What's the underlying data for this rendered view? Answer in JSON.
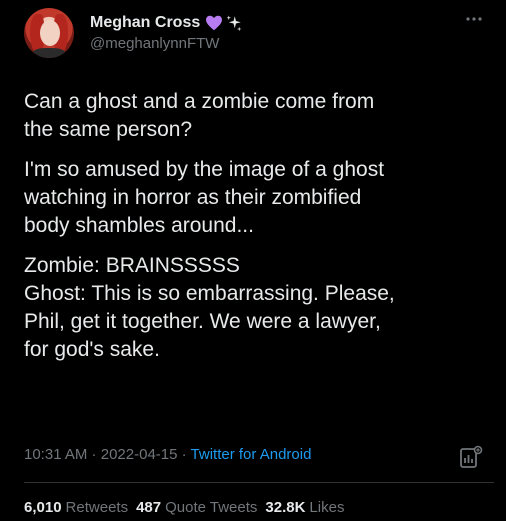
{
  "author": {
    "display_name": "Meghan Cross",
    "handle": "@meghanlynnFTW",
    "badges": [
      "purple-heart-icon",
      "sparkles-icon"
    ],
    "avatar": "user-avatar"
  },
  "tweet": {
    "paragraphs": [
      [
        "Can a ghost and a zombie come from",
        "the same person?"
      ],
      [
        "I'm so amused by the image of a ghost",
        "watching in horror as their zombified",
        "body shambles around..."
      ],
      [
        "Zombie: BRAINSSSSS",
        "Ghost: This is so embarrassing. Please,",
        "Phil, get it together. We were a lawyer,",
        "for god's sake."
      ]
    ]
  },
  "meta": {
    "time": "10:31 AM",
    "sep1": " · ",
    "date": "2022-04-15",
    "sep2": " · ",
    "source": "Twitter for Android"
  },
  "stats": {
    "retweets_count": "6,010",
    "retweets_label": "Retweets",
    "quotes_count": "487",
    "quotes_label": "Quote Tweets",
    "likes_count": "32.8K",
    "likes_label": "Likes"
  },
  "colors": {
    "background": "#000000",
    "text": "#e7e9ea",
    "secondary": "#71767b",
    "link": "#1d9bf0",
    "heart": "#b77cf0"
  }
}
